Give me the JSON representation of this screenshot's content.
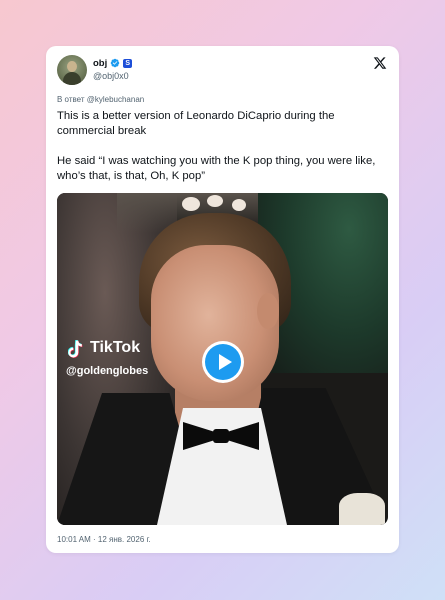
{
  "tweet": {
    "display_name": "obj",
    "handle": "@obj0x0",
    "reply_to": "В ответ @kylebuchanan",
    "text_paragraph_1": "This is a better version of Leonardo DiCaprio during the commercial break",
    "text_paragraph_2": "He said “I was watching you with the K pop thing, you were like, who’s that, is that, Oh, K pop”",
    "timestamp": "10:01 AM · 12 янв. 2026 г."
  },
  "media": {
    "watermark_brand": "TikTok",
    "watermark_handle": "@goldenglobes"
  },
  "badge": {
    "label": "S"
  },
  "icons": {
    "platform": "x-logo-icon",
    "verified": "verified-badge-icon",
    "play": "play-icon",
    "tiktok": "tiktok-icon"
  },
  "colors": {
    "accent": "#1d9bf0",
    "text": "#0f1419",
    "secondary_text": "#536471",
    "affiliate_badge": "#1d4ed8"
  }
}
